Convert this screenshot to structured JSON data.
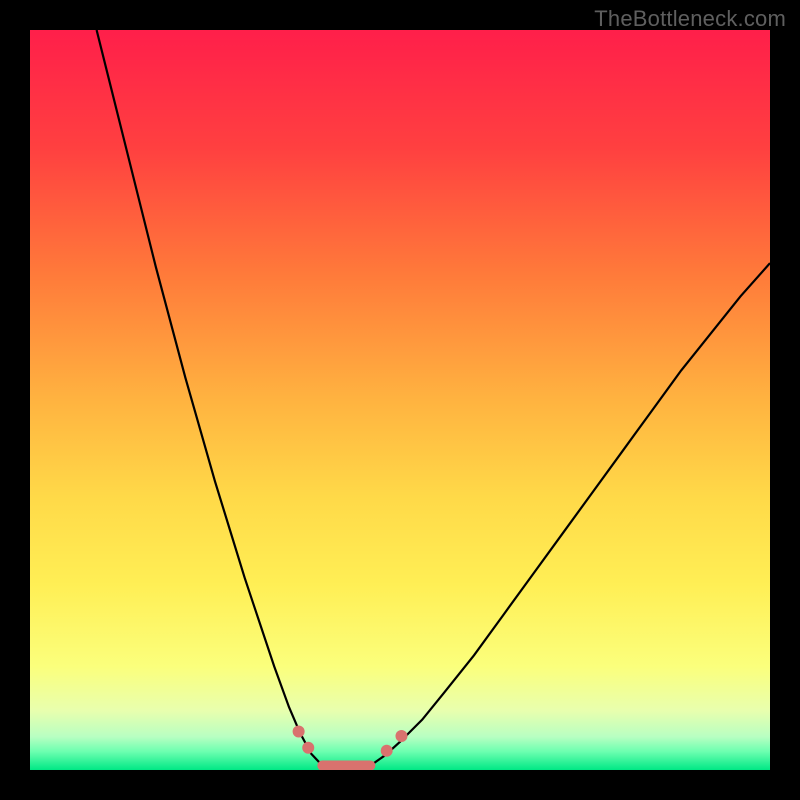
{
  "watermark": "TheBottleneck.com",
  "chart_data": {
    "type": "line",
    "title": "",
    "xlabel": "",
    "ylabel": "",
    "xlim": [
      0,
      100
    ],
    "ylim": [
      0,
      100
    ],
    "grid": false,
    "background": {
      "type": "vertical-gradient",
      "stops": [
        {
          "pos": 0.0,
          "color": "#ff1f4a"
        },
        {
          "pos": 0.16,
          "color": "#ff4040"
        },
        {
          "pos": 0.33,
          "color": "#ff7a3a"
        },
        {
          "pos": 0.5,
          "color": "#ffb340"
        },
        {
          "pos": 0.63,
          "color": "#ffd948"
        },
        {
          "pos": 0.75,
          "color": "#ffef55"
        },
        {
          "pos": 0.86,
          "color": "#fbff7c"
        },
        {
          "pos": 0.92,
          "color": "#e8ffae"
        },
        {
          "pos": 0.955,
          "color": "#b8ffc2"
        },
        {
          "pos": 0.975,
          "color": "#6dffb0"
        },
        {
          "pos": 1.0,
          "color": "#00e885"
        }
      ]
    },
    "series": [
      {
        "name": "left-curve",
        "stroke": "#000000",
        "stroke_width": 2.2,
        "x": [
          9,
          11,
          13,
          15,
          17,
          19,
          21,
          23,
          25,
          27,
          29,
          31,
          33,
          35,
          36.5,
          38,
          39.5
        ],
        "y": [
          100,
          92,
          84,
          76,
          68,
          60.5,
          53,
          46,
          39,
          32.5,
          26,
          20,
          14,
          8.5,
          5,
          2.2,
          0.6
        ]
      },
      {
        "name": "right-curve",
        "stroke": "#000000",
        "stroke_width": 2.2,
        "x": [
          46,
          48,
          50,
          53,
          56,
          60,
          64,
          68,
          72,
          76,
          80,
          84,
          88,
          92,
          96,
          100
        ],
        "y": [
          0.6,
          2.0,
          3.8,
          6.8,
          10.5,
          15.5,
          21,
          26.5,
          32,
          37.5,
          43,
          48.5,
          54,
          59,
          64,
          68.5
        ]
      },
      {
        "name": "valley-floor",
        "stroke": "#d9726e",
        "stroke_width": 10,
        "linecap": "round",
        "x": [
          39.5,
          46
        ],
        "y": [
          0.6,
          0.6
        ]
      }
    ],
    "markers": [
      {
        "name": "left-dot-1",
        "x": 36.3,
        "y": 5.2,
        "r": 6,
        "fill": "#d9726e"
      },
      {
        "name": "left-dot-2",
        "x": 37.6,
        "y": 3.0,
        "r": 6,
        "fill": "#d9726e"
      },
      {
        "name": "right-dot-1",
        "x": 48.2,
        "y": 2.6,
        "r": 6,
        "fill": "#d9726e"
      },
      {
        "name": "right-dot-2",
        "x": 50.2,
        "y": 4.6,
        "r": 6,
        "fill": "#d9726e"
      }
    ]
  }
}
